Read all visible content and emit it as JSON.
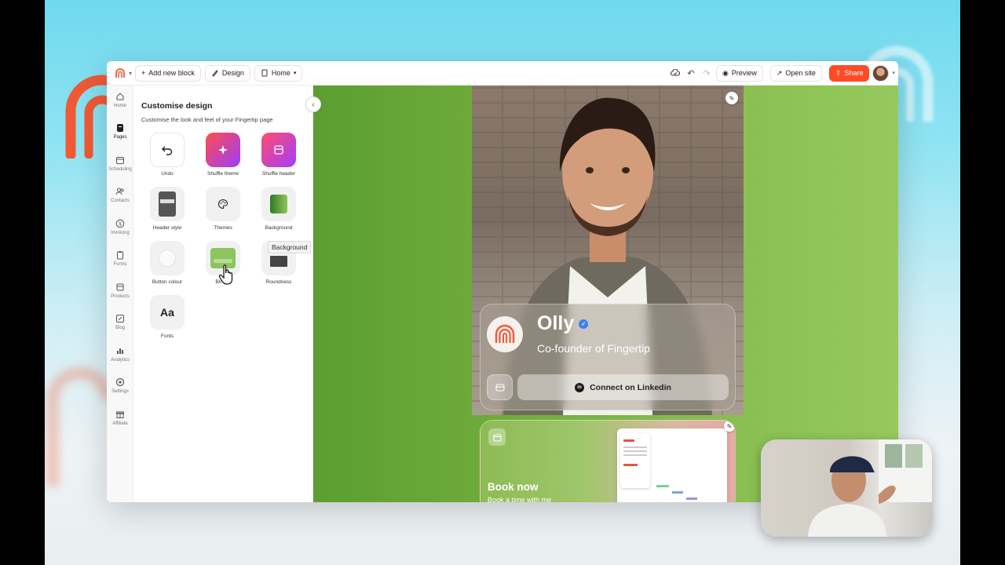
{
  "topbar": {
    "add_block": "Add new block",
    "design": "Design",
    "home": "Home",
    "preview": "Preview",
    "open_site": "Open site",
    "share": "Share"
  },
  "nav": {
    "items": [
      {
        "label": "Home",
        "icon": "home-icon"
      },
      {
        "label": "Pages",
        "icon": "pages-icon"
      },
      {
        "label": "Scheduling",
        "icon": "calendar-icon"
      },
      {
        "label": "Contacts",
        "icon": "contacts-icon"
      },
      {
        "label": "Invoicing",
        "icon": "dollar-icon"
      },
      {
        "label": "Forms",
        "icon": "clipboard-icon"
      },
      {
        "label": "Products",
        "icon": "box-icon"
      },
      {
        "label": "Blog",
        "icon": "pencil-icon"
      },
      {
        "label": "Analytics",
        "icon": "bar-chart-icon"
      },
      {
        "label": "Settings",
        "icon": "gear-icon"
      },
      {
        "label": "Affiliate",
        "icon": "gift-icon"
      }
    ],
    "active": "Pages"
  },
  "panel": {
    "title": "Customise design",
    "subtitle": "Customise the look and feel of your Fingertip page",
    "tiles": [
      {
        "label": "Undo",
        "icon": "undo-icon"
      },
      {
        "label": "Shuffle theme",
        "icon": "sparkle-icon"
      },
      {
        "label": "Shuffle header",
        "icon": "header-icon"
      },
      {
        "label": "Header style",
        "icon": "header-style-icon"
      },
      {
        "label": "Themes",
        "icon": "palette-icon"
      },
      {
        "label": "Background",
        "icon": "background-swatch-icon"
      },
      {
        "label": "Button colour",
        "icon": "button-colour-icon"
      },
      {
        "label": "Blocks",
        "icon": "block-swatch-icon"
      },
      {
        "label": "Roundness",
        "icon": "roundness-icon"
      },
      {
        "label": "Fonts",
        "icon": "fonts-icon",
        "glyph": "Aa"
      }
    ],
    "tooltip": "Background"
  },
  "profile": {
    "name": "Olly",
    "role": "Co-founder of Fingertip",
    "cta": "Connect on Linkedin"
  },
  "booking": {
    "title": "Book now",
    "subtitle": "Book a time with me"
  },
  "colors": {
    "accent": "#ff4b25",
    "canvas_green": "#7bb444",
    "verified": "#3b82f6"
  }
}
